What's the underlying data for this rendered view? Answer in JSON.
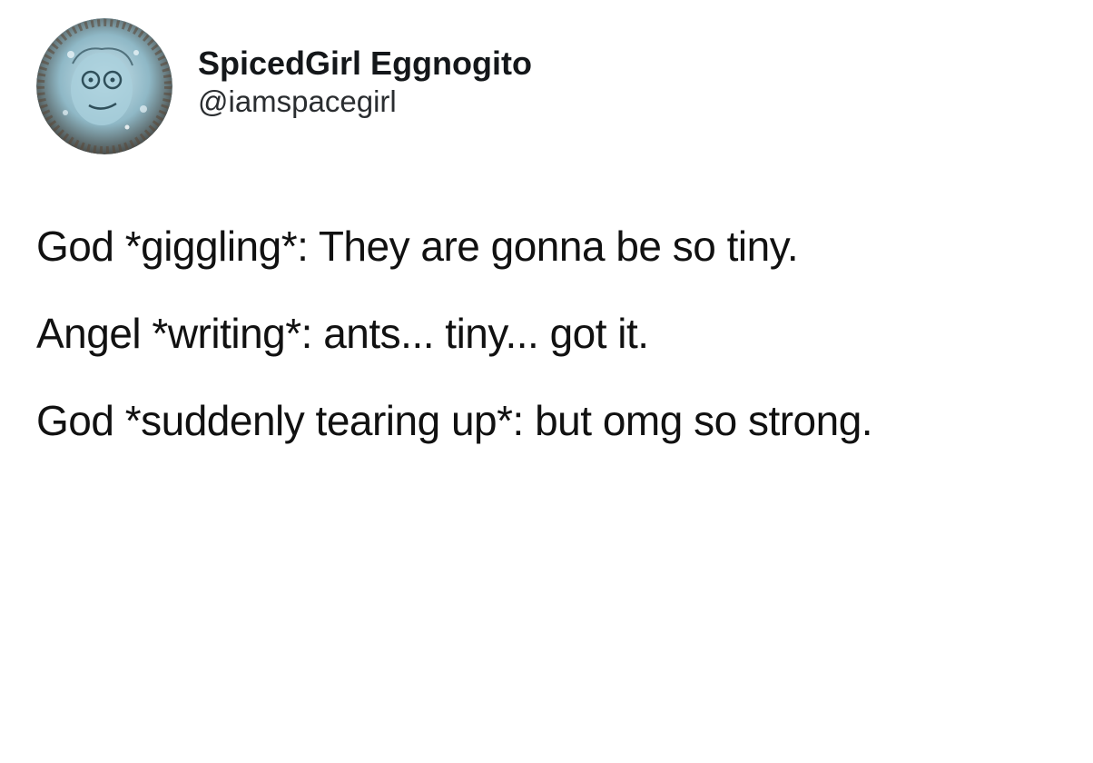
{
  "user": {
    "display_name": "SpicedGirl Eggnogito",
    "handle": "@iamspacegirl",
    "avatar_icon": "profile-avatar-illustration"
  },
  "tweet": {
    "paragraphs": [
      "God *giggling*: They are gonna be so tiny.",
      "Angel *writing*: ants... tiny... got it.",
      "God *suddenly tearing up*: but omg so strong."
    ]
  },
  "colors": {
    "background": "#ffffff",
    "text": "#14171a"
  }
}
